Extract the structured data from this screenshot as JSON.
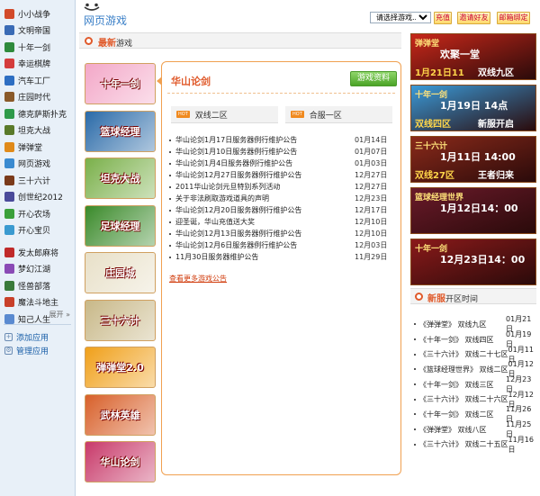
{
  "sidebar": {
    "items": [
      {
        "label": "小小战争",
        "color": "#d24a2a"
      },
      {
        "label": "文明帝国",
        "color": "#3a6bb5"
      },
      {
        "label": "十年一剑",
        "color": "#2e8a3c"
      },
      {
        "label": "幸运棋牌",
        "color": "#d43c3c"
      },
      {
        "label": "汽车工厂",
        "color": "#2d6ec2"
      },
      {
        "label": "庄园时代",
        "color": "#8a5a2a"
      },
      {
        "label": "德克萨斯扑克",
        "color": "#2e9a4a"
      },
      {
        "label": "坦克大战",
        "color": "#5a7a2a"
      },
      {
        "label": "弹弹堂",
        "color": "#e08a1a"
      },
      {
        "label": "网页游戏",
        "color": "#3a8ad0"
      },
      {
        "label": "三十六计",
        "color": "#7a3a1a"
      },
      {
        "label": "创世纪2012",
        "color": "#4a4a9a"
      },
      {
        "label": "开心农场",
        "color": "#3aa03a"
      },
      {
        "label": "开心宝贝",
        "color": "#3a9ad0"
      }
    ],
    "items2": [
      {
        "label": "发太郎麻将",
        "color": "#c02a2a"
      },
      {
        "label": "梦幻江湖",
        "color": "#8a4ab5"
      },
      {
        "label": "怪兽部落",
        "color": "#3a7a3a"
      },
      {
        "label": "魔法斗地主",
        "color": "#c8402a"
      },
      {
        "label": "知己人生",
        "color": "#5a8ad0"
      }
    ],
    "expand_label": "展开",
    "add_app": "添加应用",
    "manage_app": "管理应用"
  },
  "header": {
    "title": "网页游戏",
    "select_placeholder": "请选择游戏.......",
    "recharge": "充值",
    "invite": "邀请好友",
    "bind_email": "邮箱绑定"
  },
  "section": {
    "title_highlight": "最新",
    "title_rest": "游戏"
  },
  "thumbnails": [
    {
      "label": "十年一剑",
      "color": "#f3a8c8"
    },
    {
      "label": "篮球经理",
      "color": "#2a6aa8"
    },
    {
      "label": "坦克大战",
      "color": "#7ab04a"
    },
    {
      "label": "足球经理",
      "color": "#3a8a2a"
    },
    {
      "label": "庄园城",
      "color": "#e8e0c8"
    },
    {
      "label": "三十六计",
      "color": "#c8b888"
    },
    {
      "label": "弹弹堂2.0",
      "color": "#f0a01a"
    },
    {
      "label": "武林英雄",
      "color": "#d8602a"
    },
    {
      "label": "华山论剑",
      "color": "#c83a6a"
    }
  ],
  "game": {
    "title": "华山论剑",
    "info_button": "游戏资料",
    "hot_tag": "HOT",
    "servers": [
      "双线二区",
      "合服一区"
    ],
    "news": [
      {
        "title": "华山论剑1月17日服务器例行维护公告",
        "date": "01月14日"
      },
      {
        "title": "华山论剑1月10日服务器例行维护公告",
        "date": "01月07日"
      },
      {
        "title": "华山论剑1月4日服务器例行维护公告",
        "date": "01月03日"
      },
      {
        "title": "华山论剑12月27日服务器例行维护公告",
        "date": "12月27日"
      },
      {
        "title": "2011华山论剑元旦特别系列活动",
        "date": "12月27日"
      },
      {
        "title": "关于非法刷取游戏道具的声明",
        "date": "12月23日"
      },
      {
        "title": "华山论剑12月20日服务器例行维护公告",
        "date": "12月17日"
      },
      {
        "title": "迎圣诞，华山充值送大奖",
        "date": "12月10日"
      },
      {
        "title": "华山论剑12月13日服务器例行维护公告",
        "date": "12月10日"
      },
      {
        "title": "华山论剑12月6日服务器例行维护公告",
        "date": "12月03日"
      },
      {
        "title": "11月30日服务器维护公告",
        "date": "11月29日"
      }
    ],
    "more_link": "查看更多游戏公告"
  },
  "banners": [
    {
      "game": "弹弹堂",
      "headline": "欢聚一堂",
      "detail": "1月21日11",
      "server": "双线九区",
      "bg": "#c8281a"
    },
    {
      "game": "十年一剑",
      "headline": "1月19日 14点",
      "detail": "双线四区",
      "server": "新服开启",
      "bg": "#3a9ad8"
    },
    {
      "game": "三十六计",
      "headline": "1月11日 14:00",
      "detail": "双线27区",
      "server": "王者归来",
      "bg": "#8a2a1a"
    },
    {
      "game": "篮球经理世界",
      "headline": "1月12日14：00",
      "detail": "",
      "server": "",
      "bg": "#6a1a2a"
    },
    {
      "game": "十年一剑",
      "headline": "12月23日14：00",
      "detail": "",
      "server": "",
      "bg": "#8a1a1a"
    }
  ],
  "new_servers": {
    "title_highlight": "新服",
    "title_rest": "开区时间",
    "items": [
      {
        "name": "《弹弹堂》 双线九区",
        "date": "01月21日"
      },
      {
        "name": "《十年一剑》 双线四区",
        "date": "01月19日"
      },
      {
        "name": "《三十六计》 双线二十七区",
        "date": "01月11日"
      },
      {
        "name": "《篮球经理世界》 双线二区",
        "date": "01月12日"
      },
      {
        "name": "《十年一剑》 双线三区",
        "date": "12月23日"
      },
      {
        "name": "《三十六计》 双线二十六区",
        "date": "12月12日"
      },
      {
        "name": "《十年一剑》 双线二区",
        "date": "11月26日"
      },
      {
        "name": "《弹弹堂》 双线八区",
        "date": "11月25日"
      },
      {
        "name": "《三十六计》 双线二十五区",
        "date": "11月16日"
      }
    ]
  }
}
